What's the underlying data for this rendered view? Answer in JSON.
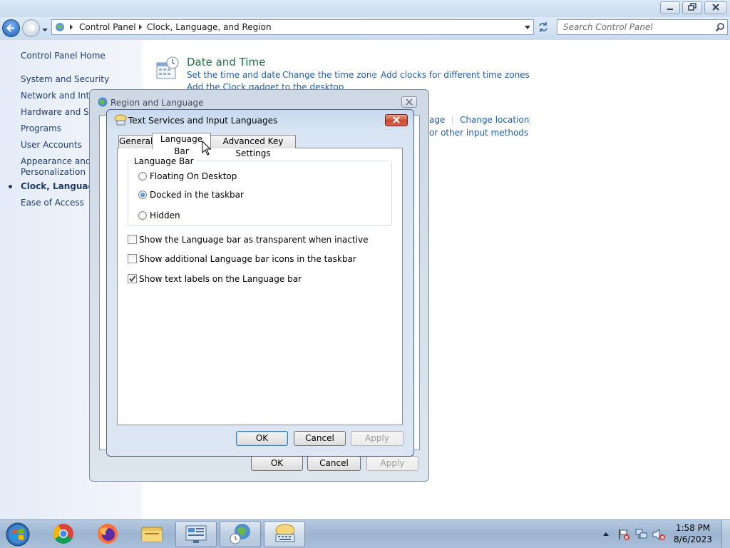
{
  "explorer": {
    "breadcrumb": [
      "Control Panel",
      "Clock, Language, and Region"
    ],
    "search_placeholder": "Search Control Panel"
  },
  "left_nav": {
    "home": "Control Panel Home",
    "items": [
      {
        "label": "System and Security"
      },
      {
        "label": "Network and Inter"
      },
      {
        "label": "Hardware and Sou"
      },
      {
        "label": "Programs"
      },
      {
        "label": "User Accounts"
      },
      {
        "label": "Appearance and\nPersonalization"
      },
      {
        "label": "Clock, Language, a",
        "current": true
      },
      {
        "label": "Ease of Access"
      }
    ]
  },
  "content": {
    "date_time": {
      "title": "Date and Time",
      "links": [
        "Set the time and date",
        "Change the time zone",
        "Add clocks for different time zones",
        "Add the Clock gadget to the desktop"
      ]
    },
    "region_links": [
      "age",
      "Change location",
      "or other input methods"
    ]
  },
  "region_dialog": {
    "title": "Region and Language",
    "buttons": {
      "ok": "OK",
      "cancel": "Cancel",
      "apply": "Apply"
    }
  },
  "tsil_dialog": {
    "title": "Text Services and Input Languages",
    "tabs": [
      {
        "label": "General",
        "active": false
      },
      {
        "label": "Language Bar",
        "active": true
      },
      {
        "label": "Advanced Key Settings",
        "active": false
      }
    ],
    "groupbox_label": "Language Bar",
    "radios": [
      {
        "label": "Floating On Desktop",
        "checked": false
      },
      {
        "label": "Docked in the taskbar",
        "checked": true
      },
      {
        "label": "Hidden",
        "checked": false
      }
    ],
    "checkboxes": [
      {
        "label": "Show the Language bar as transparent when inactive",
        "checked": false
      },
      {
        "label": "Show additional Language bar icons in the taskbar",
        "checked": false
      },
      {
        "label": "Show text labels on the Language bar",
        "checked": true
      }
    ],
    "buttons": {
      "ok": "OK",
      "cancel": "Cancel",
      "apply": "Apply"
    }
  },
  "taskbar": {
    "time": "1:58 PM",
    "date": "8/6/2023",
    "apps": [
      "start-orb-icon",
      "chrome-icon",
      "firefox-icon",
      "file-explorer-icon",
      "control-panel-icon",
      "region-language-icon",
      "text-services-icon"
    ]
  },
  "colors": {
    "link": "#1f5fa6",
    "section_title": "#1e7145",
    "nav_text": "#1e3b6a"
  }
}
